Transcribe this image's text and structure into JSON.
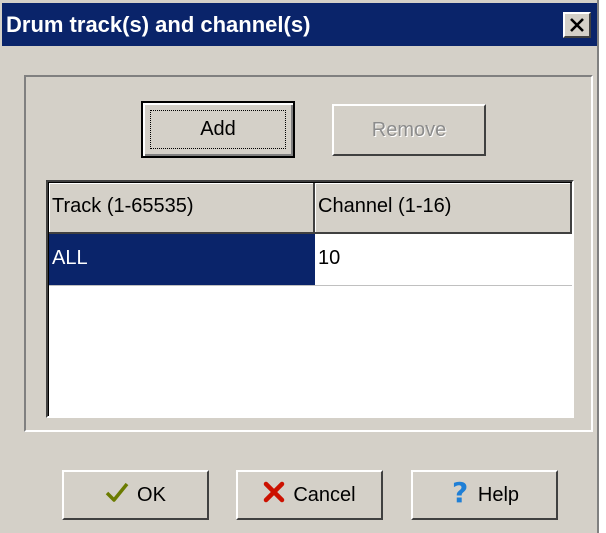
{
  "window": {
    "title": "Drum track(s) and channel(s)"
  },
  "buttons": {
    "add": "Add",
    "remove": "Remove",
    "ok": "OK",
    "cancel": "Cancel",
    "help": "Help"
  },
  "grid": {
    "columns": [
      "Track (1-65535)",
      "Channel (1-16)"
    ],
    "rows": [
      {
        "track": "ALL",
        "channel": "10"
      }
    ]
  },
  "colors": {
    "titlebar": "#0a246a",
    "face": "#d4d0c8",
    "selection": "#0a246a",
    "ok_check": "#6b7b00",
    "cancel_x": "#cc1100",
    "help_q": "#1f7fd6"
  }
}
